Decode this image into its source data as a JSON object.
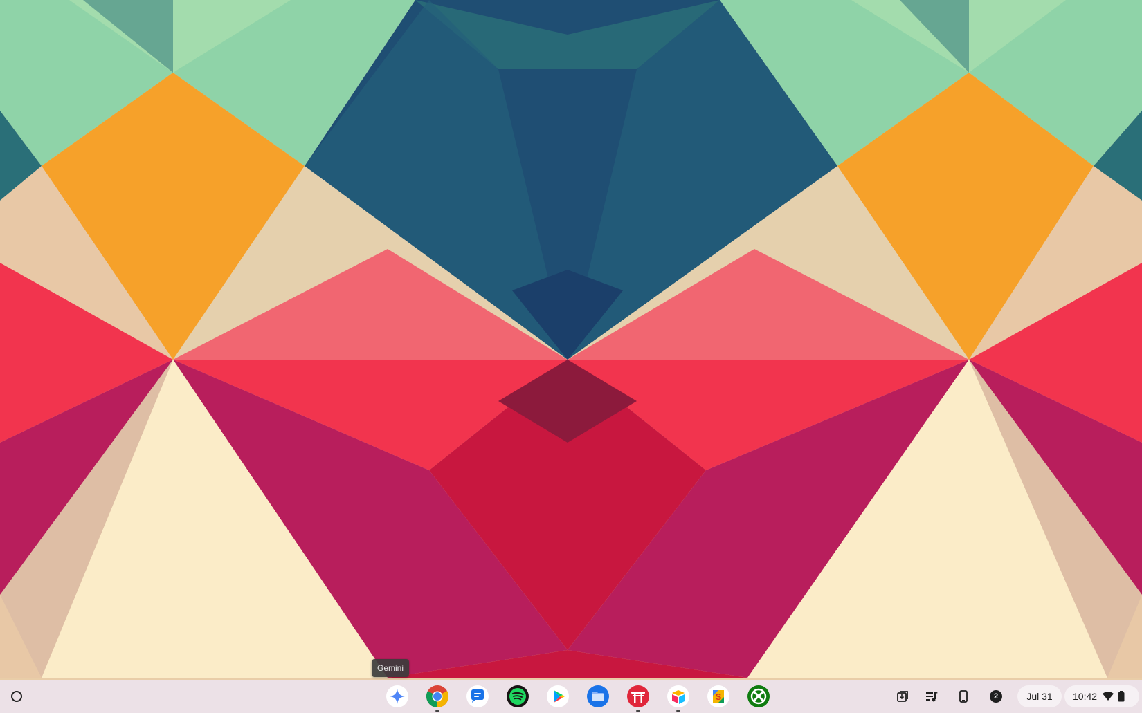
{
  "wallpaper": {
    "colors": {
      "mint": "#8fd3a8",
      "teal": "#2a6f78",
      "navy": "#1f4e73",
      "orange": "#f6a12a",
      "red": "#f2344e",
      "crimson": "#c8173f",
      "magenta": "#b81e5c",
      "cream": "#fbecc8",
      "beige": "#e8c8a6"
    }
  },
  "tooltip": {
    "text": "Gemini"
  },
  "shelf": {
    "launcher_icon": "launcher-circle-icon",
    "apps": [
      {
        "name": "Gemini",
        "icon": "gemini-icon",
        "running": false
      },
      {
        "name": "Chrome",
        "icon": "chrome-icon",
        "running": true
      },
      {
        "name": "Messages",
        "icon": "messages-icon",
        "running": false
      },
      {
        "name": "Spotify",
        "icon": "spotify-icon",
        "running": false
      },
      {
        "name": "Play Store",
        "icon": "play-store-icon",
        "running": false
      },
      {
        "name": "Files",
        "icon": "files-icon",
        "running": false
      },
      {
        "name": "Torii app",
        "icon": "torii-icon",
        "running": true
      },
      {
        "name": "Airtable",
        "icon": "airtable-icon",
        "running": true
      },
      {
        "name": "Slides",
        "icon": "slides-icon",
        "running": false
      },
      {
        "name": "Xbox",
        "icon": "xbox-icon",
        "running": false
      }
    ],
    "tray": {
      "holding_space_icon": "holding-space-icon",
      "media_icon": "media-controls-icon",
      "phone_hub_icon": "phone-hub-icon",
      "notification_count": "2",
      "date": "Jul 31",
      "time": "10:42",
      "wifi_icon": "wifi-icon",
      "battery_icon": "battery-icon"
    }
  }
}
